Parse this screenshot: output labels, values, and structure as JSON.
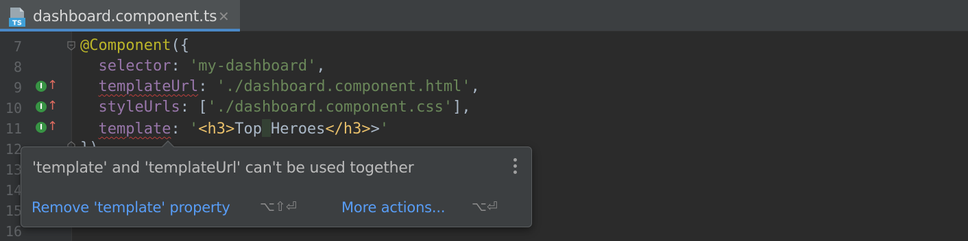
{
  "tab": {
    "icon_label": "TS",
    "title": "dashboard.component.ts",
    "close": "✕"
  },
  "line_numbers": [
    "7",
    "8",
    "9",
    "10",
    "11",
    "12",
    "13",
    "14",
    "15",
    "16"
  ],
  "gutter_markers": {
    "letter": "I",
    "arrow": "↑"
  },
  "code": {
    "l7": {
      "deco": "@Component",
      "rest": "({"
    },
    "l8": {
      "indent": "  ",
      "key": "selector",
      "colon": ": ",
      "value": "'my-dashboard'",
      "end": ","
    },
    "l9": {
      "indent": "  ",
      "key": "templateUrl",
      "colon": ": ",
      "value": "'./dashboard.component.html'",
      "end": ","
    },
    "l10": {
      "indent": "  ",
      "key": "styleUrls",
      "colon": ": [",
      "value": "'./dashboard.component.css'",
      "end": "],"
    },
    "l11": {
      "indent": "  ",
      "key": "template",
      "colon": ": ",
      "q1": "'",
      "t1": "<h3>",
      "txt1": "Top",
      "txt2": "Heroes",
      "t2": "</h3>",
      "t3": ">",
      "q2": "'"
    },
    "l12": {
      "text": "})"
    }
  },
  "popup": {
    "message": "'template' and 'templateUrl' can't be used together",
    "action_1": "Remove 'template' property",
    "shortcut_1": "⌥⇧⏎",
    "action_2": "More actions...",
    "shortcut_2": "⌥⏎"
  },
  "colors": {
    "background": "#2b2b2b",
    "gutter": "#313335",
    "accent": "#4a88c7",
    "link": "#589df6",
    "string": "#6a8759",
    "property": "#9876aa",
    "decorator": "#bbb529",
    "tag": "#e8bf6a",
    "error": "#bc3f3c"
  }
}
